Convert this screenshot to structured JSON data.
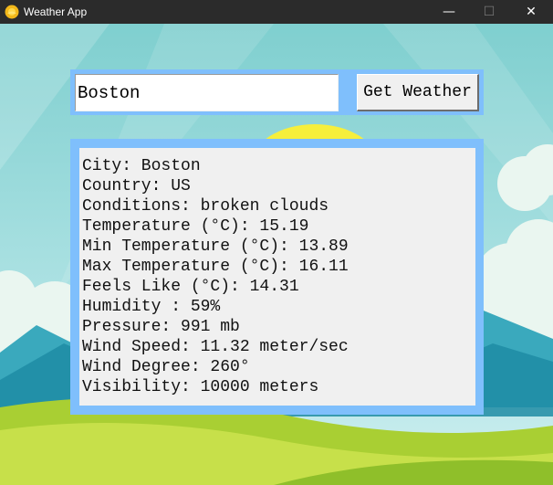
{
  "window": {
    "title": "Weather App",
    "minimize_glyph": "—",
    "maximize_glyph": "☐",
    "close_glyph": "✕",
    "icon": "sun-icon"
  },
  "search": {
    "city_value": "Boston",
    "button_label": "Get Weather"
  },
  "results": {
    "lines": [
      "City: Boston",
      "Country: US",
      "Conditions: broken clouds",
      "Temperature (°C): 15.19",
      "Min Temperature (°C): 13.89",
      "Max Temperature (°C): 16.11",
      "Feels Like (°C): 14.31",
      "Humidity : 59%",
      "Pressure: 991 mb",
      "Wind Speed: 11.32 meter/sec",
      "Wind Degree: 260°",
      "Visibility: 10000 meters"
    ]
  },
  "colors": {
    "frame": "#7fbffc",
    "panel": "#f0f0f0",
    "titlebar": "#2b2b2b",
    "sky": "#8fd3d0",
    "grass": "#b6d63a"
  }
}
